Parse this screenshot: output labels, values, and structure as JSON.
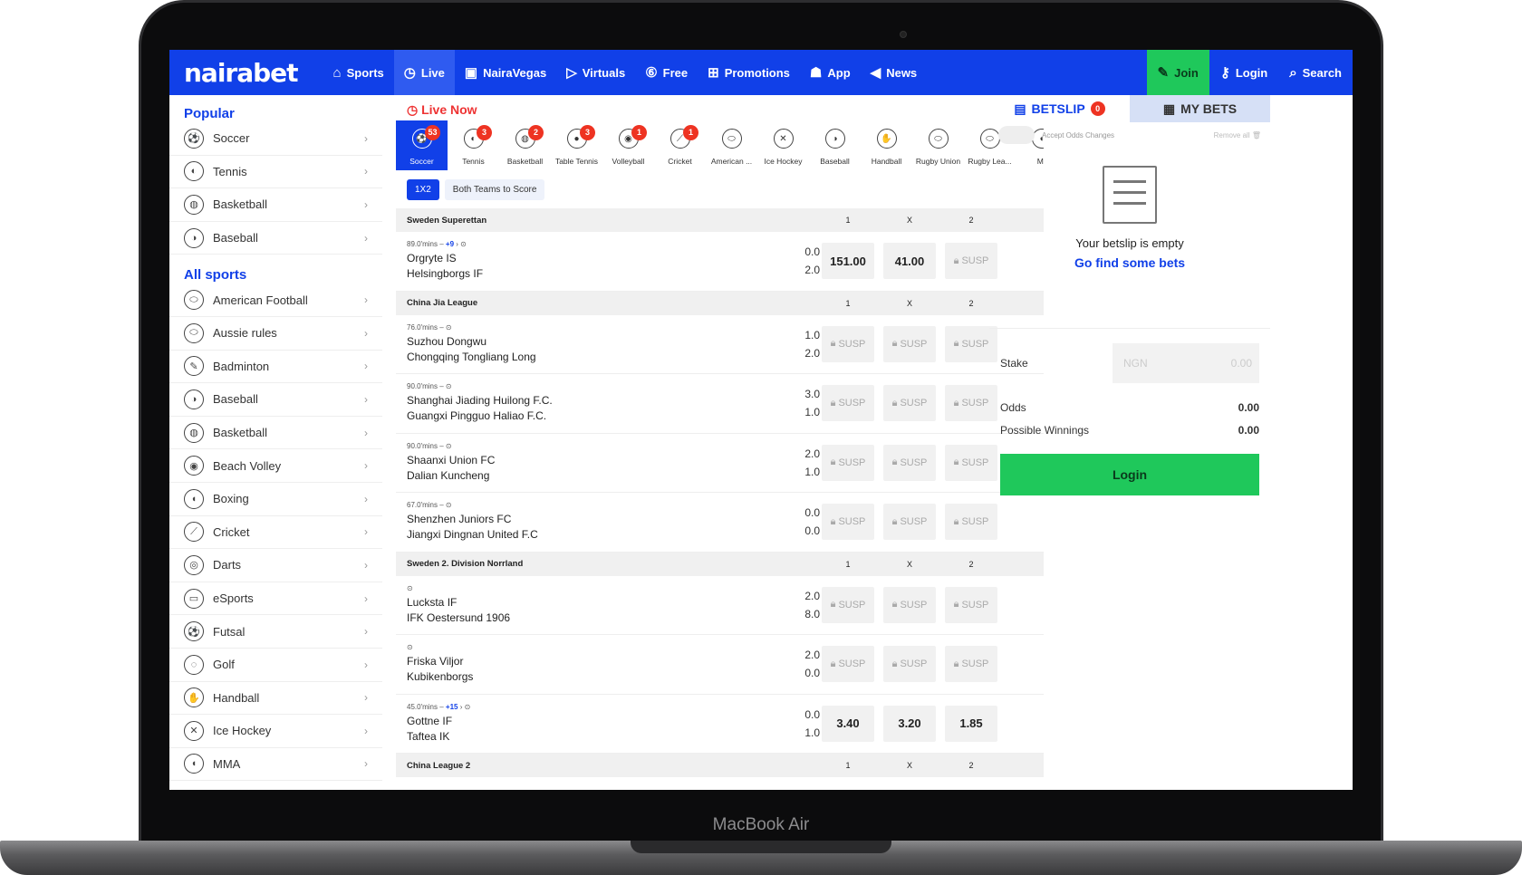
{
  "device": {
    "brand": "MacBook Air"
  },
  "nav": {
    "logo": "nairabet",
    "items": [
      {
        "icon": "⌂",
        "label": "Sports"
      },
      {
        "icon": "◷",
        "label": "Live"
      },
      {
        "icon": "▣",
        "label": "NairaVegas"
      },
      {
        "icon": "▷",
        "label": "Virtuals"
      },
      {
        "icon": "⑥",
        "label": "Free"
      },
      {
        "icon": "⊞",
        "label": "Promotions"
      },
      {
        "icon": "☗",
        "label": "App"
      },
      {
        "icon": "◀",
        "label": "News"
      }
    ],
    "join": "Join",
    "login": "Login",
    "search": "Search"
  },
  "sidebar": {
    "popular_title": "Popular",
    "popular": [
      {
        "icon": "⚽",
        "label": "Soccer"
      },
      {
        "icon": "◐",
        "label": "Tennis"
      },
      {
        "icon": "◍",
        "label": "Basketball"
      },
      {
        "icon": "◑",
        "label": "Baseball"
      }
    ],
    "all_title": "All sports",
    "all": [
      {
        "icon": "⬭",
        "label": "American Football"
      },
      {
        "icon": "⬭",
        "label": "Aussie rules"
      },
      {
        "icon": "✎",
        "label": "Badminton"
      },
      {
        "icon": "◑",
        "label": "Baseball"
      },
      {
        "icon": "◍",
        "label": "Basketball"
      },
      {
        "icon": "◉",
        "label": "Beach Volley"
      },
      {
        "icon": "◖",
        "label": "Boxing"
      },
      {
        "icon": "⟋",
        "label": "Cricket"
      },
      {
        "icon": "◎",
        "label": "Darts"
      },
      {
        "icon": "▭",
        "label": "eSports"
      },
      {
        "icon": "⚽",
        "label": "Futsal"
      },
      {
        "icon": "◌",
        "label": "Golf"
      },
      {
        "icon": "✋",
        "label": "Handball"
      },
      {
        "icon": "✕",
        "label": "Ice Hockey"
      },
      {
        "icon": "◖",
        "label": "MMA"
      }
    ]
  },
  "live": {
    "title": "Live Now",
    "sports": [
      {
        "label": "Soccer",
        "count": "53",
        "icon": "⚽"
      },
      {
        "label": "Tennis",
        "count": "3",
        "icon": "◐"
      },
      {
        "label": "Basketball",
        "count": "2",
        "icon": "◍"
      },
      {
        "label": "Table Tennis",
        "count": "3",
        "icon": "●"
      },
      {
        "label": "Volleyball",
        "count": "1",
        "icon": "◉"
      },
      {
        "label": "Cricket",
        "count": "1",
        "icon": "⟋"
      },
      {
        "label": "American ...",
        "count": "",
        "icon": "⬭"
      },
      {
        "label": "Ice Hockey",
        "count": "",
        "icon": "✕"
      },
      {
        "label": "Baseball",
        "count": "",
        "icon": "◑"
      },
      {
        "label": "Handball",
        "count": "",
        "icon": "✋"
      },
      {
        "label": "Rugby Union",
        "count": "",
        "icon": "⬭"
      },
      {
        "label": "Rugby Lea...",
        "count": "",
        "icon": "⬭"
      },
      {
        "label": "MI",
        "count": "",
        "icon": "◖"
      }
    ],
    "markets": [
      "1X2",
      "Both Teams to Score"
    ],
    "col_headers": [
      "1",
      "X",
      "2"
    ],
    "susp_label": "SUSP",
    "leagues": [
      {
        "name": "Sweden Superettan",
        "matches": [
          {
            "time": "89.0'mins",
            "more": "+9",
            "home": "Orgryte IS",
            "away": "Helsingborgs IF",
            "h1": "0.0",
            "h2": "2.0",
            "odds": [
              "151.00",
              "41.00",
              "SUSP"
            ]
          }
        ]
      },
      {
        "name": "China Jia League",
        "matches": [
          {
            "time": "76.0'mins",
            "more": "",
            "home": "Suzhou Dongwu",
            "away": "Chongqing Tongliang Long",
            "h1": "1.0",
            "h2": "2.0",
            "odds": [
              "SUSP",
              "SUSP",
              "SUSP"
            ]
          },
          {
            "time": "90.0'mins",
            "more": "",
            "home": "Shanghai Jiading Huilong F.C.",
            "away": "Guangxi Pingguo Haliao F.C.",
            "h1": "3.0",
            "h2": "1.0",
            "odds": [
              "SUSP",
              "SUSP",
              "SUSP"
            ]
          },
          {
            "time": "90.0'mins",
            "more": "",
            "home": "Shaanxi Union FC",
            "away": "Dalian Kuncheng",
            "h1": "2.0",
            "h2": "1.0",
            "odds": [
              "SUSP",
              "SUSP",
              "SUSP"
            ]
          },
          {
            "time": "67.0'mins",
            "more": "",
            "home": "Shenzhen Juniors FC",
            "away": "Jiangxi Dingnan United F.C",
            "h1": "0.0",
            "h2": "0.0",
            "odds": [
              "SUSP",
              "SUSP",
              "SUSP"
            ]
          }
        ]
      },
      {
        "name": "Sweden 2. Division Norrland",
        "matches": [
          {
            "time": "",
            "more": "",
            "home": "Lucksta IF",
            "away": "IFK Oestersund 1906",
            "h1": "2.0",
            "h2": "8.0",
            "odds": [
              "SUSP",
              "SUSP",
              "SUSP"
            ]
          },
          {
            "time": "",
            "more": "",
            "home": "Friska Viljor",
            "away": "Kubikenborgs",
            "h1": "2.0",
            "h2": "0.0",
            "odds": [
              "SUSP",
              "SUSP",
              "SUSP"
            ]
          },
          {
            "time": "45.0'mins",
            "more": "+15",
            "home": "Gottne IF",
            "away": "Taftea IK",
            "h1": "0.0",
            "h2": "1.0",
            "odds": [
              "3.40",
              "3.20",
              "1.85"
            ]
          }
        ]
      },
      {
        "name": "China League 2",
        "matches": []
      }
    ]
  },
  "betslip": {
    "tab_betslip": "BETSLIP",
    "count": "0",
    "tab_mybets": "MY BETS",
    "accept_odds": "Accept Odds Changes",
    "remove_all": "Remove all",
    "empty_text": "Your betslip is empty",
    "empty_link": "Go find some bets",
    "stake_label": "Stake",
    "currency": "NGN",
    "stake_value": "0.00",
    "odds_label": "Odds",
    "odds_value": "0.00",
    "winnings_label": "Possible Winnings",
    "winnings_value": "0.00",
    "login_button": "Login"
  },
  "colors": {
    "primary": "#1140e8",
    "join_green": "#1fc85b",
    "badge_red": "#e32"
  }
}
